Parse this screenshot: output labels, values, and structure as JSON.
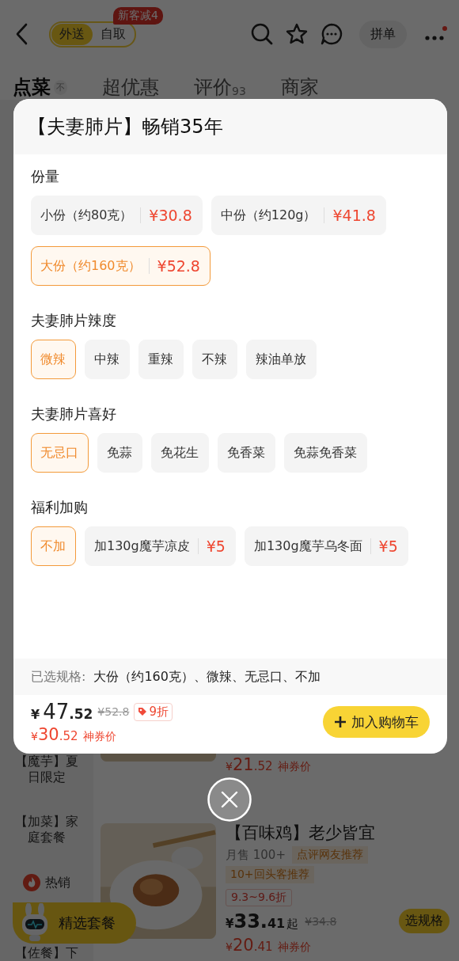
{
  "header": {
    "modes": [
      {
        "label": "外送",
        "selected": true
      },
      {
        "label": "自取",
        "selected": false
      }
    ],
    "promo_badge": "新客减4",
    "group_button": "拼单",
    "more_has_dot": true
  },
  "tabs": [
    {
      "label": "点菜",
      "selected": true,
      "tag": "不"
    },
    {
      "label": "超优惠",
      "selected": false
    },
    {
      "label": "评价",
      "selected": false,
      "count": "93"
    },
    {
      "label": "商家",
      "selected": false
    }
  ],
  "sidebar": {
    "items": [
      {
        "label": "【魔芋】夏日限定",
        "kind": "text"
      },
      {
        "label": "【加菜】家庭套餐",
        "kind": "text"
      },
      {
        "label": "热销",
        "kind": "hot"
      },
      {
        "label": "【佐餐】下",
        "kind": "text"
      }
    ]
  },
  "products": [
    {
      "kind": "partial",
      "coupon_currency": "¥",
      "coupon_int": "21",
      "coupon_dec": ".52",
      "coupon_label": "神券价"
    },
    {
      "kind": "full",
      "name": "【百味鸡】老少皆宜",
      "sales": "月售 100+",
      "tags": [
        "点评网友推荐",
        "10+回头客推荐"
      ],
      "discount": "9.3~9.6折",
      "currency": "¥",
      "price_int": "33.",
      "price_dec": "41",
      "suffix": "起",
      "original": "¥34.8",
      "button": "选规格",
      "coupon_currency": "¥",
      "coupon_int": "20",
      "coupon_dec": ".41",
      "coupon_label": "神券价"
    }
  ],
  "floating_button": "精选套餐",
  "modal": {
    "title": "【夫妻肺片】畅销35年",
    "groups": [
      {
        "title": "份量",
        "options": [
          {
            "label": "小份（约80克）",
            "price": "¥30.8",
            "selected": false
          },
          {
            "label": "中份（约120g）",
            "price": "¥41.8",
            "selected": false
          },
          {
            "label": "大份（约160克）",
            "price": "¥52.8",
            "selected": true
          }
        ]
      },
      {
        "title": "夫妻肺片辣度",
        "options": [
          {
            "label": "微辣",
            "selected": true
          },
          {
            "label": "中辣",
            "selected": false
          },
          {
            "label": "重辣",
            "selected": false
          },
          {
            "label": "不辣",
            "selected": false
          },
          {
            "label": "辣油单放",
            "selected": false
          }
        ]
      },
      {
        "title": "夫妻肺片喜好",
        "options": [
          {
            "label": "无忌口",
            "selected": true
          },
          {
            "label": "免蒜",
            "selected": false
          },
          {
            "label": "免花生",
            "selected": false
          },
          {
            "label": "免香菜",
            "selected": false
          },
          {
            "label": "免蒜免香菜",
            "selected": false
          }
        ]
      },
      {
        "title": "福利加购",
        "options": [
          {
            "label": "不加",
            "selected": true
          },
          {
            "label": "加130g魔芋凉皮",
            "price": "¥5",
            "selected": false
          },
          {
            "label": "加130g魔芋乌冬面",
            "price": "¥5",
            "selected": false
          }
        ]
      }
    ],
    "summary_label": "已选规格:",
    "summary": "大份（约160克）、微辣、无忌口、不加",
    "currency": "¥",
    "price_int": "47",
    "price_dec": ".52",
    "original": "¥52.8",
    "discount": "9折",
    "coupon_currency": "¥",
    "coupon_int": "30",
    "coupon_dec": ".52",
    "coupon_label": "神券价",
    "add_button": "加入购物车"
  }
}
